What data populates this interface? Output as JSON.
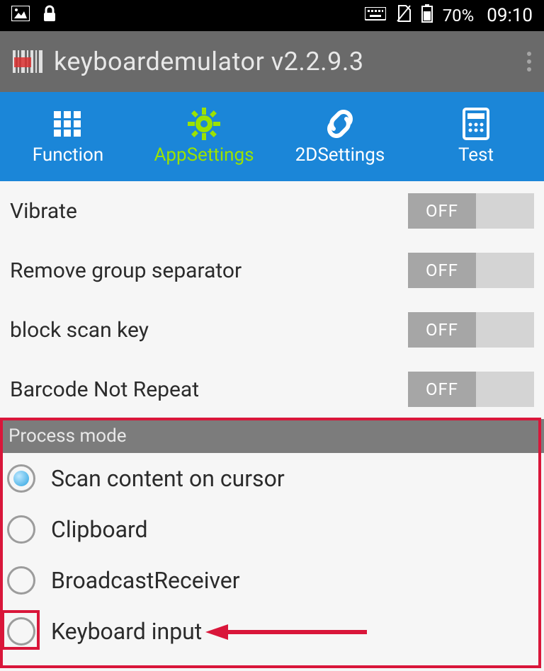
{
  "status": {
    "battery_pct": "70%",
    "time": "09:10"
  },
  "app": {
    "title": "keyboardemulator v2.2.9.3"
  },
  "tabs": {
    "function": "Function",
    "appsettings": "AppSettings",
    "twodsettings": "2DSettings",
    "test": "Test"
  },
  "settings": {
    "vibrate": {
      "label": "Vibrate",
      "value": "OFF"
    },
    "remove_group_separator": {
      "label": "Remove group separator",
      "value": "OFF"
    },
    "block_scan_key": {
      "label": "block scan key",
      "value": "OFF"
    },
    "barcode_not_repeat": {
      "label": "Barcode Not Repeat",
      "value": "OFF"
    }
  },
  "section": {
    "process_mode": "Process mode"
  },
  "radios": {
    "scan_cursor": "Scan content on cursor",
    "clipboard": "Clipboard",
    "broadcast": "BroadcastReceiver",
    "keyboard": "Keyboard input"
  }
}
